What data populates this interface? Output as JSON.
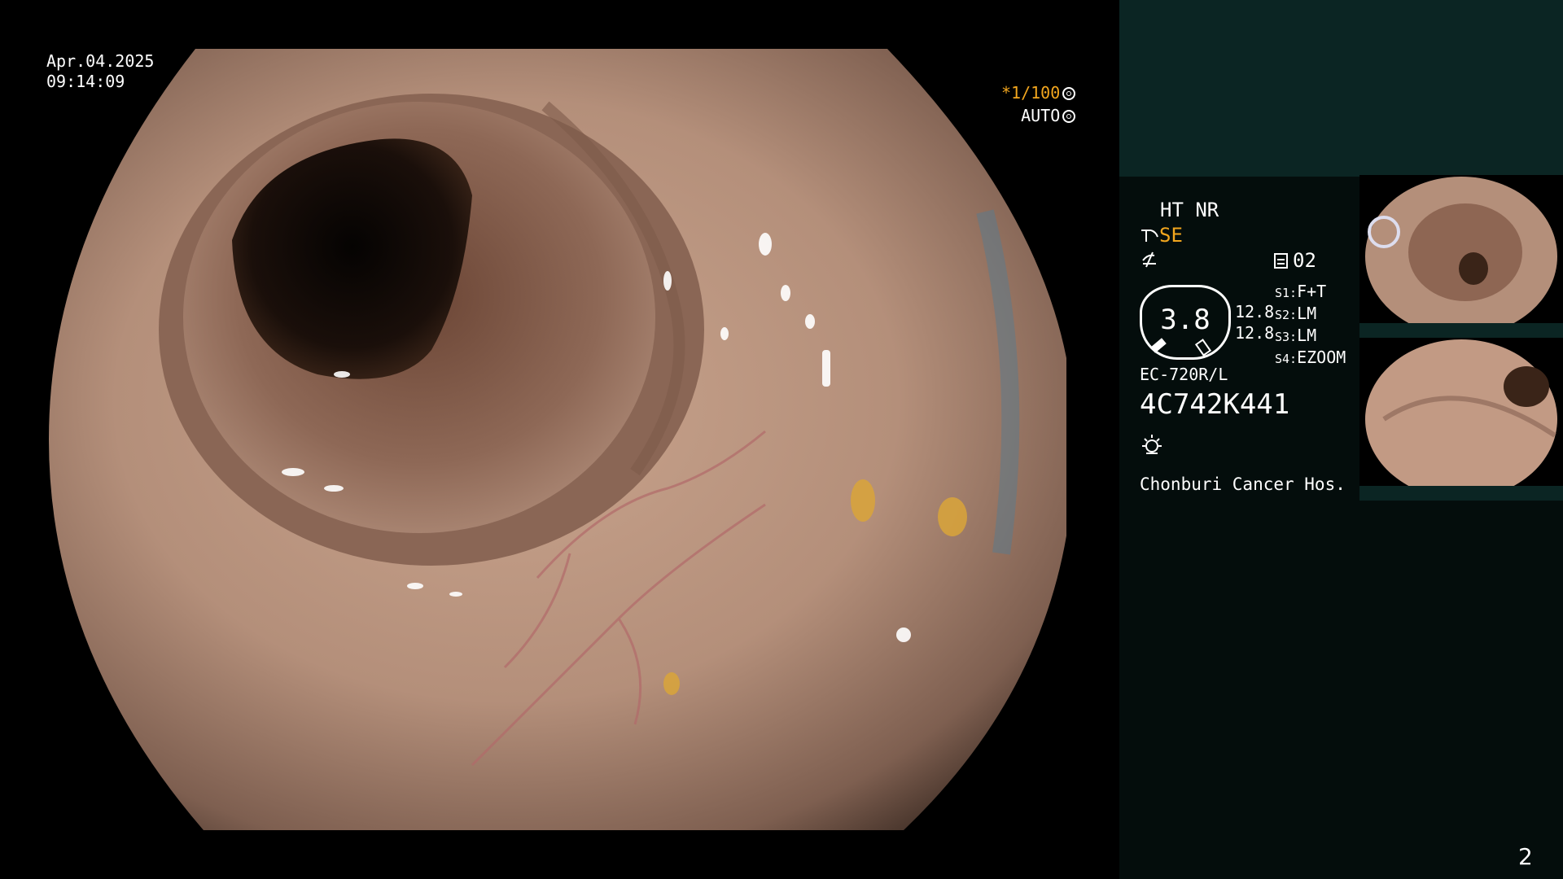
{
  "overlay": {
    "date": "Apr.04.2025",
    "time": "09:14:09",
    "shutter": "*1/100",
    "iris_mode": "AUTO"
  },
  "panel": {
    "enhancement": "HT NR",
    "structure": "SE",
    "memo_count": "02",
    "gauge_value": "3.8",
    "side_value_1": "12.8",
    "side_value_2": "12.8",
    "switches": [
      {
        "key": "S1:",
        "value": "F+T"
      },
      {
        "key": "S2:",
        "value": "LM"
      },
      {
        "key": "S3:",
        "value": "LM"
      },
      {
        "key": "S4:",
        "value": "EZOOM"
      }
    ],
    "scope_model": "EC-720R/L",
    "scope_serial": "4C742K441",
    "hospital": "Chonburi Cancer Hos."
  },
  "page_number": "2",
  "colors": {
    "accent_orange": "#f2a61e",
    "panel_bg": "#040d0c",
    "panel_top_bg": "#0b2523",
    "mucosa": "#b48f7a"
  },
  "icons": [
    "shutter-icon",
    "iris-icon",
    "structure-icon",
    "filter-icon",
    "memo-icon",
    "light-icon"
  ]
}
